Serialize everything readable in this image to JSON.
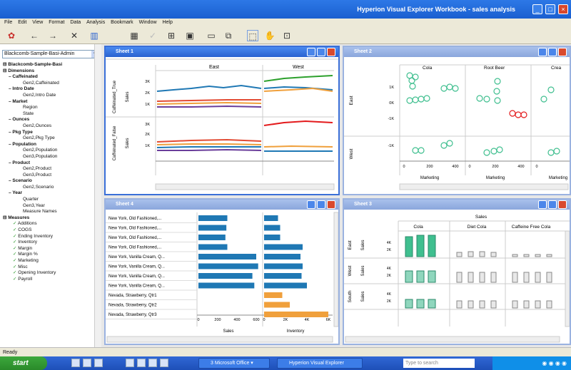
{
  "window": {
    "title": "Hyperion Visual Explorer Workbook - sales analysis"
  },
  "menu": [
    "File",
    "Edit",
    "View",
    "Format",
    "Data",
    "Analysis",
    "Bookmark",
    "Window",
    "Help"
  ],
  "toolbar_icons": [
    "app-icon",
    "back-icon",
    "forward-icon",
    "tools-icon",
    "chart-icon",
    "grid-icon",
    "check-icon",
    "table-icon",
    "save-icon",
    "window-icon",
    "windows-icon",
    "select-icon",
    "hand-icon",
    "zoom-icon"
  ],
  "left": {
    "dropdown": "Blackcomb-Sample-Basi-Admin",
    "root": "Blackcomb-Sample-Basi",
    "groups": [
      {
        "label": "Dimensions",
        "level": 0
      },
      {
        "label": "Caffeinated",
        "level": 1
      },
      {
        "label": "Gen2,Caffeinated",
        "level": 2
      },
      {
        "label": "Intro Date",
        "level": 1
      },
      {
        "label": "Gen2,Intro Date",
        "level": 2
      },
      {
        "label": "Market",
        "level": 1
      },
      {
        "label": "Region",
        "level": 2
      },
      {
        "label": "State",
        "level": 2
      },
      {
        "label": "Ounces",
        "level": 1
      },
      {
        "label": "Gen2,Ounces",
        "level": 2
      },
      {
        "label": "Pkg Type",
        "level": 1
      },
      {
        "label": "Gen2,Pkg Type",
        "level": 2
      },
      {
        "label": "Population",
        "level": 1
      },
      {
        "label": "Gen2,Population",
        "level": 2
      },
      {
        "label": "Gen3,Population",
        "level": 2
      },
      {
        "label": "Product",
        "level": 1
      },
      {
        "label": "Gen2,Product",
        "level": 2
      },
      {
        "label": "Gen3,Product",
        "level": 2
      },
      {
        "label": "Scenario",
        "level": 1
      },
      {
        "label": "Gen2,Scenario",
        "level": 2
      },
      {
        "label": "Year",
        "level": 1
      },
      {
        "label": "Quarter",
        "level": 2
      },
      {
        "label": "Gen3,Year",
        "level": 2
      },
      {
        "label": "Measure Names",
        "level": 2
      },
      {
        "label": "Measures",
        "level": 0
      },
      {
        "label": "Additions",
        "level": 3
      },
      {
        "label": "COGS",
        "level": 3
      },
      {
        "label": "Ending Inventory",
        "level": 3
      },
      {
        "label": "Inventory",
        "level": 3
      },
      {
        "label": "Margin",
        "level": 3
      },
      {
        "label": "Margin %",
        "level": 3
      },
      {
        "label": "Marketing",
        "level": 3
      },
      {
        "label": "Misc",
        "level": 3
      },
      {
        "label": "Opening Inventory",
        "level": 3
      },
      {
        "label": "Payroll",
        "level": 3
      }
    ]
  },
  "sheets": {
    "s1": {
      "title": "Sheet 1",
      "regions": [
        "East",
        "West"
      ],
      "rows": [
        "Caffeinated_True",
        "Caffeinated_False"
      ],
      "measure": "Sales",
      "ticks": [
        "3K",
        "2K",
        "1K"
      ]
    },
    "s2": {
      "title": "Sheet 2",
      "cols": [
        "Cola",
        "Root Beer",
        "Crea"
      ],
      "rows": [
        "East",
        "West"
      ],
      "xlabel": "Marketing",
      "xticks": [
        "0",
        "200",
        "400"
      ],
      "yticks": [
        "1K",
        "0K",
        "-1K"
      ]
    },
    "s4": {
      "title": "Sheet 4",
      "rows": [
        "New York, Old Fashioned,...",
        "New York, Old Fashioned,...",
        "New York, Old Fashioned,...",
        "New York, Old Fashioned,...",
        "New York, Vanilla Cream, Q...",
        "New York, Vanilla Cream, Q...",
        "New York, Vanilla Cream, Q...",
        "New York, Vanilla Cream, Q...",
        "Nevada, Strawberry, Qtr1",
        "Nevada, Strawberry, Qtr2",
        "Nevada, Strawberry, Qtr3"
      ],
      "sales": [
        300,
        290,
        280,
        300,
        600,
        620,
        560,
        580,
        0,
        0,
        0
      ],
      "inventory": [
        1.3,
        1.5,
        1.5,
        3.6,
        3.4,
        3.6,
        3.5,
        4.0,
        1.7,
        2.4,
        6.0
      ],
      "xlabel1": "Sales",
      "xlabel2": "Inventory",
      "xticks1": [
        "0",
        "200",
        "400",
        "600"
      ],
      "xticks2": [
        "0",
        "2K",
        "4K",
        "6K"
      ]
    },
    "s3": {
      "title": "Sheet 3",
      "header": "Sales",
      "cols": [
        "Cola",
        "Diet Cola",
        "Caffeine Free Cola"
      ],
      "rows": [
        "East",
        "West",
        "South"
      ],
      "measure": "Sales",
      "yticks": [
        "4K",
        "2K"
      ]
    }
  },
  "status": "Ready",
  "taskbar": {
    "start": "start",
    "tasks": [
      "3 Microsoft Office ▾",
      "Hyperion Visual Explorer"
    ],
    "search": "Type to search"
  },
  "colors": {
    "accent": "#2a62d0",
    "bar_blue": "#1f78b4",
    "bar_orange": "#f0a03c",
    "green": "#3fbf8f"
  }
}
